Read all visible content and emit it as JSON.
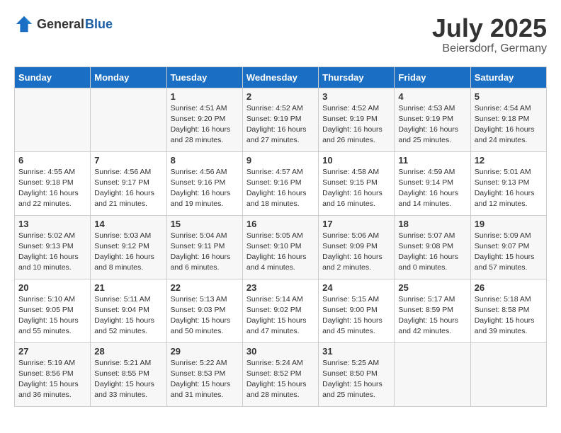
{
  "header": {
    "logo_general": "General",
    "logo_blue": "Blue",
    "month_year": "July 2025",
    "location": "Beiersdorf, Germany"
  },
  "weekdays": [
    "Sunday",
    "Monday",
    "Tuesday",
    "Wednesday",
    "Thursday",
    "Friday",
    "Saturday"
  ],
  "weeks": [
    [
      {
        "day": "",
        "info": ""
      },
      {
        "day": "",
        "info": ""
      },
      {
        "day": "1",
        "info": "Sunrise: 4:51 AM\nSunset: 9:20 PM\nDaylight: 16 hours\nand 28 minutes."
      },
      {
        "day": "2",
        "info": "Sunrise: 4:52 AM\nSunset: 9:19 PM\nDaylight: 16 hours\nand 27 minutes."
      },
      {
        "day": "3",
        "info": "Sunrise: 4:52 AM\nSunset: 9:19 PM\nDaylight: 16 hours\nand 26 minutes."
      },
      {
        "day": "4",
        "info": "Sunrise: 4:53 AM\nSunset: 9:19 PM\nDaylight: 16 hours\nand 25 minutes."
      },
      {
        "day": "5",
        "info": "Sunrise: 4:54 AM\nSunset: 9:18 PM\nDaylight: 16 hours\nand 24 minutes."
      }
    ],
    [
      {
        "day": "6",
        "info": "Sunrise: 4:55 AM\nSunset: 9:18 PM\nDaylight: 16 hours\nand 22 minutes."
      },
      {
        "day": "7",
        "info": "Sunrise: 4:56 AM\nSunset: 9:17 PM\nDaylight: 16 hours\nand 21 minutes."
      },
      {
        "day": "8",
        "info": "Sunrise: 4:56 AM\nSunset: 9:16 PM\nDaylight: 16 hours\nand 19 minutes."
      },
      {
        "day": "9",
        "info": "Sunrise: 4:57 AM\nSunset: 9:16 PM\nDaylight: 16 hours\nand 18 minutes."
      },
      {
        "day": "10",
        "info": "Sunrise: 4:58 AM\nSunset: 9:15 PM\nDaylight: 16 hours\nand 16 minutes."
      },
      {
        "day": "11",
        "info": "Sunrise: 4:59 AM\nSunset: 9:14 PM\nDaylight: 16 hours\nand 14 minutes."
      },
      {
        "day": "12",
        "info": "Sunrise: 5:01 AM\nSunset: 9:13 PM\nDaylight: 16 hours\nand 12 minutes."
      }
    ],
    [
      {
        "day": "13",
        "info": "Sunrise: 5:02 AM\nSunset: 9:13 PM\nDaylight: 16 hours\nand 10 minutes."
      },
      {
        "day": "14",
        "info": "Sunrise: 5:03 AM\nSunset: 9:12 PM\nDaylight: 16 hours\nand 8 minutes."
      },
      {
        "day": "15",
        "info": "Sunrise: 5:04 AM\nSunset: 9:11 PM\nDaylight: 16 hours\nand 6 minutes."
      },
      {
        "day": "16",
        "info": "Sunrise: 5:05 AM\nSunset: 9:10 PM\nDaylight: 16 hours\nand 4 minutes."
      },
      {
        "day": "17",
        "info": "Sunrise: 5:06 AM\nSunset: 9:09 PM\nDaylight: 16 hours\nand 2 minutes."
      },
      {
        "day": "18",
        "info": "Sunrise: 5:07 AM\nSunset: 9:08 PM\nDaylight: 16 hours\nand 0 minutes."
      },
      {
        "day": "19",
        "info": "Sunrise: 5:09 AM\nSunset: 9:07 PM\nDaylight: 15 hours\nand 57 minutes."
      }
    ],
    [
      {
        "day": "20",
        "info": "Sunrise: 5:10 AM\nSunset: 9:05 PM\nDaylight: 15 hours\nand 55 minutes."
      },
      {
        "day": "21",
        "info": "Sunrise: 5:11 AM\nSunset: 9:04 PM\nDaylight: 15 hours\nand 52 minutes."
      },
      {
        "day": "22",
        "info": "Sunrise: 5:13 AM\nSunset: 9:03 PM\nDaylight: 15 hours\nand 50 minutes."
      },
      {
        "day": "23",
        "info": "Sunrise: 5:14 AM\nSunset: 9:02 PM\nDaylight: 15 hours\nand 47 minutes."
      },
      {
        "day": "24",
        "info": "Sunrise: 5:15 AM\nSunset: 9:00 PM\nDaylight: 15 hours\nand 45 minutes."
      },
      {
        "day": "25",
        "info": "Sunrise: 5:17 AM\nSunset: 8:59 PM\nDaylight: 15 hours\nand 42 minutes."
      },
      {
        "day": "26",
        "info": "Sunrise: 5:18 AM\nSunset: 8:58 PM\nDaylight: 15 hours\nand 39 minutes."
      }
    ],
    [
      {
        "day": "27",
        "info": "Sunrise: 5:19 AM\nSunset: 8:56 PM\nDaylight: 15 hours\nand 36 minutes."
      },
      {
        "day": "28",
        "info": "Sunrise: 5:21 AM\nSunset: 8:55 PM\nDaylight: 15 hours\nand 33 minutes."
      },
      {
        "day": "29",
        "info": "Sunrise: 5:22 AM\nSunset: 8:53 PM\nDaylight: 15 hours\nand 31 minutes."
      },
      {
        "day": "30",
        "info": "Sunrise: 5:24 AM\nSunset: 8:52 PM\nDaylight: 15 hours\nand 28 minutes."
      },
      {
        "day": "31",
        "info": "Sunrise: 5:25 AM\nSunset: 8:50 PM\nDaylight: 15 hours\nand 25 minutes."
      },
      {
        "day": "",
        "info": ""
      },
      {
        "day": "",
        "info": ""
      }
    ]
  ]
}
